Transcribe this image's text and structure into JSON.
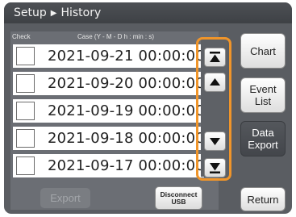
{
  "header": {
    "root": "Setup",
    "current": "History"
  },
  "table": {
    "col_check": "Check",
    "col_case": "Case (Y - M - D h : min : s)",
    "rows": [
      {
        "case": "2021-09-21  00:00:00",
        "checked": false
      },
      {
        "case": "2021-09-20  00:00:00",
        "checked": false
      },
      {
        "case": "2021-09-19  00:00:00",
        "checked": false
      },
      {
        "case": "2021-09-18  00:00:00",
        "checked": false
      },
      {
        "case": "2021-09-17  00:00:00",
        "checked": false
      }
    ]
  },
  "scroll": {
    "icons": [
      "page-up-icon",
      "scroll-up-icon",
      "scroll-down-icon",
      "page-down-icon"
    ],
    "highlight_color": "#f0952a"
  },
  "side_buttons": {
    "chart": "Chart",
    "event_list_line1": "Event",
    "event_list_line2": "List",
    "data_export_line1": "Data",
    "data_export_line2": "Export",
    "return": "Return"
  },
  "bottom_buttons": {
    "export": "Export",
    "disconnect_line1": "Disconnect",
    "disconnect_line2": "USB"
  }
}
